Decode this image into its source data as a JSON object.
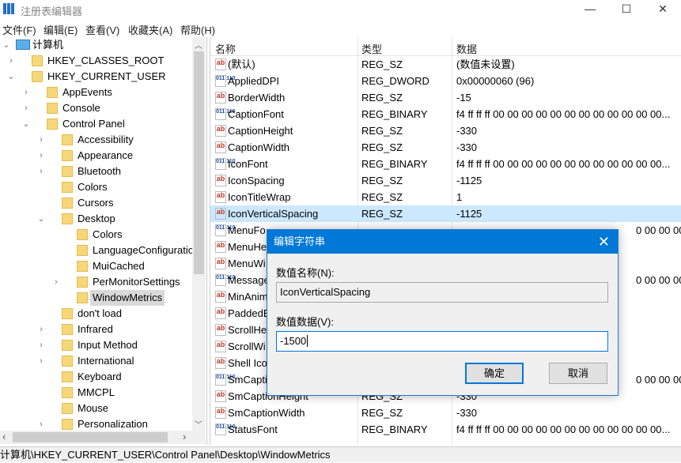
{
  "window": {
    "title": "注册表编辑器",
    "minimize": "—",
    "maximize": "☐",
    "close": "✕"
  },
  "menu": [
    "文件(F)",
    "编辑(E)",
    "查看(V)",
    "收藏夹(A)",
    "帮助(H)"
  ],
  "tree": [
    {
      "label": "计算机",
      "level": 0,
      "exp": "open",
      "icon": "computer"
    },
    {
      "label": "HKEY_CLASSES_ROOT",
      "level": 1,
      "exp": "closed"
    },
    {
      "label": "HKEY_CURRENT_USER",
      "level": 1,
      "exp": "open"
    },
    {
      "label": "AppEvents",
      "level": 2,
      "exp": "closed"
    },
    {
      "label": "Console",
      "level": 2,
      "exp": "closed"
    },
    {
      "label": "Control Panel",
      "level": 2,
      "exp": "open"
    },
    {
      "label": "Accessibility",
      "level": 3,
      "exp": "closed"
    },
    {
      "label": "Appearance",
      "level": 3,
      "exp": "closed"
    },
    {
      "label": "Bluetooth",
      "level": 3,
      "exp": "closed"
    },
    {
      "label": "Colors",
      "level": 3,
      "exp": ""
    },
    {
      "label": "Cursors",
      "level": 3,
      "exp": ""
    },
    {
      "label": "Desktop",
      "level": 3,
      "exp": "open"
    },
    {
      "label": "Colors",
      "level": 4,
      "exp": ""
    },
    {
      "label": "LanguageConfiguratio",
      "level": 4,
      "exp": ""
    },
    {
      "label": "MuiCached",
      "level": 4,
      "exp": ""
    },
    {
      "label": "PerMonitorSettings",
      "level": 4,
      "exp": "closed"
    },
    {
      "label": "WindowMetrics",
      "level": 4,
      "exp": "",
      "selected": true
    },
    {
      "label": "don't load",
      "level": 3,
      "exp": ""
    },
    {
      "label": "Infrared",
      "level": 3,
      "exp": "closed"
    },
    {
      "label": "Input Method",
      "level": 3,
      "exp": "closed"
    },
    {
      "label": "International",
      "level": 3,
      "exp": "closed"
    },
    {
      "label": "Keyboard",
      "level": 3,
      "exp": ""
    },
    {
      "label": "MMCPL",
      "level": 3,
      "exp": ""
    },
    {
      "label": "Mouse",
      "level": 3,
      "exp": ""
    },
    {
      "label": "Personalization",
      "level": 3,
      "exp": "closed"
    }
  ],
  "list": {
    "headers": [
      "名称",
      "类型",
      "数据"
    ],
    "rows": [
      {
        "name": "(默认)",
        "type": "REG_SZ",
        "data": "(数值未设置)",
        "icon": "sz"
      },
      {
        "name": "AppliedDPI",
        "type": "REG_DWORD",
        "data": "0x00000060 (96)",
        "icon": "bin"
      },
      {
        "name": "BorderWidth",
        "type": "REG_SZ",
        "data": "-15",
        "icon": "sz"
      },
      {
        "name": "CaptionFont",
        "type": "REG_BINARY",
        "data": "f4 ff ff ff 00 00 00 00 00 00 00 00 00 00 00 00...",
        "icon": "bin"
      },
      {
        "name": "CaptionHeight",
        "type": "REG_SZ",
        "data": "-330",
        "icon": "sz"
      },
      {
        "name": "CaptionWidth",
        "type": "REG_SZ",
        "data": "-330",
        "icon": "sz"
      },
      {
        "name": "IconFont",
        "type": "REG_BINARY",
        "data": "f4 ff ff ff 00 00 00 00 00 00 00 00 00 00 00 00...",
        "icon": "bin"
      },
      {
        "name": "IconSpacing",
        "type": "REG_SZ",
        "data": "-1125",
        "icon": "sz"
      },
      {
        "name": "IconTitleWrap",
        "type": "REG_SZ",
        "data": "1",
        "icon": "sz"
      },
      {
        "name": "IconVerticalSpacing",
        "type": "REG_SZ",
        "data": "-1125",
        "icon": "sz",
        "highlight": true
      },
      {
        "name": "MenuFo",
        "type": "",
        "data": "0 00 00 00...",
        "icon": "bin"
      },
      {
        "name": "MenuHe",
        "type": "",
        "data": "",
        "icon": "sz"
      },
      {
        "name": "MenuWi",
        "type": "",
        "data": "",
        "icon": "sz"
      },
      {
        "name": "Message",
        "type": "",
        "data": "0 00 00 00...",
        "icon": "bin"
      },
      {
        "name": "MinAnim",
        "type": "",
        "data": "",
        "icon": "sz"
      },
      {
        "name": "PaddedB",
        "type": "",
        "data": "",
        "icon": "sz"
      },
      {
        "name": "ScrollHe",
        "type": "",
        "data": "",
        "icon": "sz"
      },
      {
        "name": "ScrollWi",
        "type": "",
        "data": "",
        "icon": "sz"
      },
      {
        "name": "Shell Ico",
        "type": "",
        "data": "",
        "icon": "sz"
      },
      {
        "name": "SmCapti",
        "type": "",
        "data": "0 00 00 00...",
        "icon": "bin"
      },
      {
        "name": "SmCaptionHeight",
        "type": "REG_SZ",
        "data": "-330",
        "icon": "sz"
      },
      {
        "name": "SmCaptionWidth",
        "type": "REG_SZ",
        "data": "-330",
        "icon": "sz"
      },
      {
        "name": "StatusFont",
        "type": "REG_BINARY",
        "data": "f4 ff ff ff 00 00 00 00 00 00 00 00 00 00 00 00...",
        "icon": "bin"
      }
    ]
  },
  "status": "计算机\\HKEY_CURRENT_USER\\Control Panel\\Desktop\\WindowMetrics",
  "dialog": {
    "title": "编辑字符串",
    "name_label": "数值名称(N):",
    "name_value": "IconVerticalSpacing",
    "data_label": "数值数据(V):",
    "data_value": "-1500",
    "ok": "确定",
    "cancel": "取消",
    "close": "✕"
  },
  "colors": {
    "accent": "#0078d7",
    "selection": "#cce8ff",
    "folder": "#f6d77a"
  }
}
